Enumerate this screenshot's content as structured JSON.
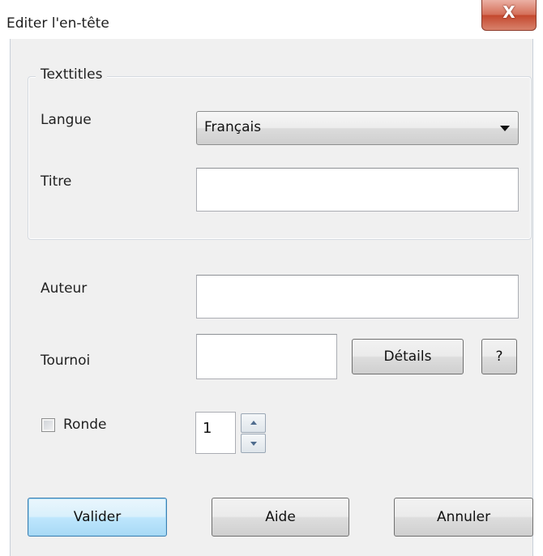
{
  "window": {
    "title": "Editer l'en-tête",
    "close_glyph": "X",
    "close_icon": "close-icon"
  },
  "group": {
    "label": "Texttitles"
  },
  "fields": {
    "language_label": "Langue",
    "language_value": "Français",
    "language_arrow_icon": "chevron-down-icon",
    "title_label": "Titre",
    "title_value": "",
    "author_label": "Auteur",
    "author_value": "",
    "tournament_label": "Tournoi",
    "tournament_value": "",
    "details_button": "Détails",
    "help_small_button": "?",
    "round_label": "Ronde",
    "round_checked": false,
    "round_value": "1"
  },
  "buttons": {
    "ok": "Valider",
    "help": "Aide",
    "cancel": "Annuler"
  },
  "colors": {
    "close_button": "#c4492f",
    "default_button_border": "#3c7fb1"
  }
}
